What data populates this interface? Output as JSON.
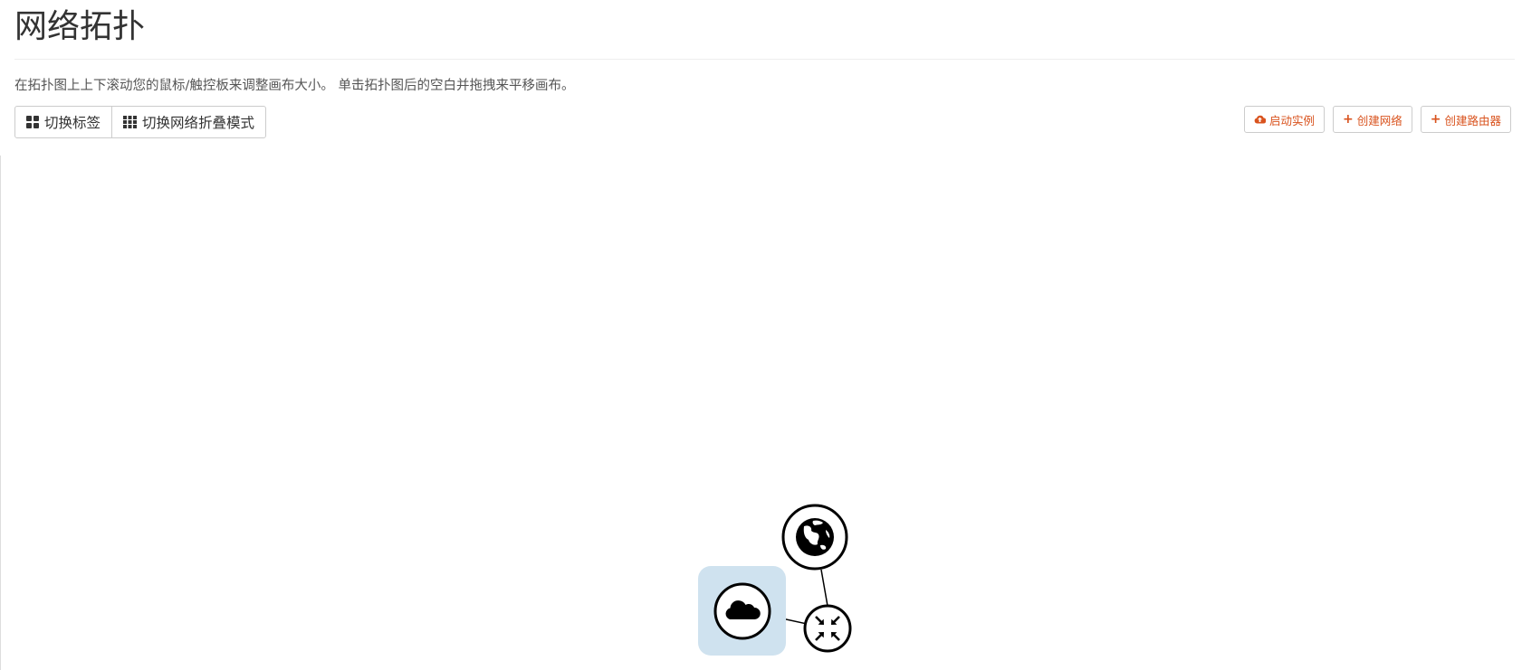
{
  "page": {
    "title": "网络拓扑",
    "help_text": "在拓扑图上上下滚动您的鼠标/触控板来调整画布大小。 单击拓扑图后的空白并拖拽来平移画布。"
  },
  "toolbar": {
    "toggle_labels": {
      "label": "切换标签",
      "icon": "th-large-icon"
    },
    "toggle_network_collapse": {
      "label": "切换网络折叠模式",
      "icon": "th-icon"
    }
  },
  "actions": {
    "launch_instance": {
      "label": "启动实例",
      "icon": "cloud-upload-icon"
    },
    "create_network": {
      "label": "创建网络",
      "icon": "plus-icon"
    },
    "create_router": {
      "label": "创建路由器",
      "icon": "plus-icon"
    }
  },
  "topology": {
    "nodes": [
      {
        "type": "external-network",
        "icon": "globe-icon"
      },
      {
        "type": "network",
        "icon": "cloud-icon",
        "highlight_color": "#cfe2ef"
      },
      {
        "type": "router",
        "icon": "arrows-inward-icon"
      }
    ]
  },
  "colors": {
    "accent": "#d9531e",
    "node_highlight": "#cfe2ef",
    "text": "#333333"
  }
}
